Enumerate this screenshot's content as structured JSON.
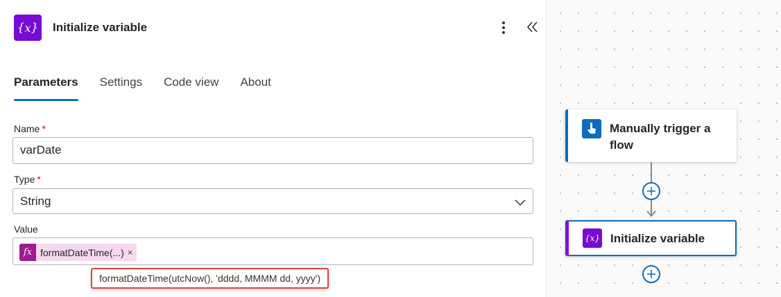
{
  "panel": {
    "title": "Initialize variable",
    "icon": "variable-icon",
    "accent_color": "#770bd6",
    "tabs": [
      {
        "label": "Parameters",
        "active": true
      },
      {
        "label": "Settings",
        "active": false
      },
      {
        "label": "Code view",
        "active": false
      },
      {
        "label": "About",
        "active": false
      }
    ],
    "fields": {
      "name": {
        "label": "Name",
        "required_mark": "*",
        "value": "varDate"
      },
      "type": {
        "label": "Type",
        "required_mark": "*",
        "value": "String"
      },
      "value": {
        "label": "Value",
        "token": {
          "icon_glyph": "fx",
          "label": "formatDateTime(...)",
          "remove_glyph": "×",
          "color": "#a01a8e"
        }
      }
    },
    "tooltip": {
      "text": "formatDateTime(utcNow(), 'dddd, MMMM dd, yyyy')",
      "border_color": "#e0413b"
    }
  },
  "canvas": {
    "nodes": [
      {
        "title": "Manually trigger a flow",
        "icon": "touch-icon",
        "color": "#0f6cbd"
      },
      {
        "title": "Initialize variable",
        "icon": "variable-icon",
        "color": "#770bd6"
      }
    ]
  }
}
